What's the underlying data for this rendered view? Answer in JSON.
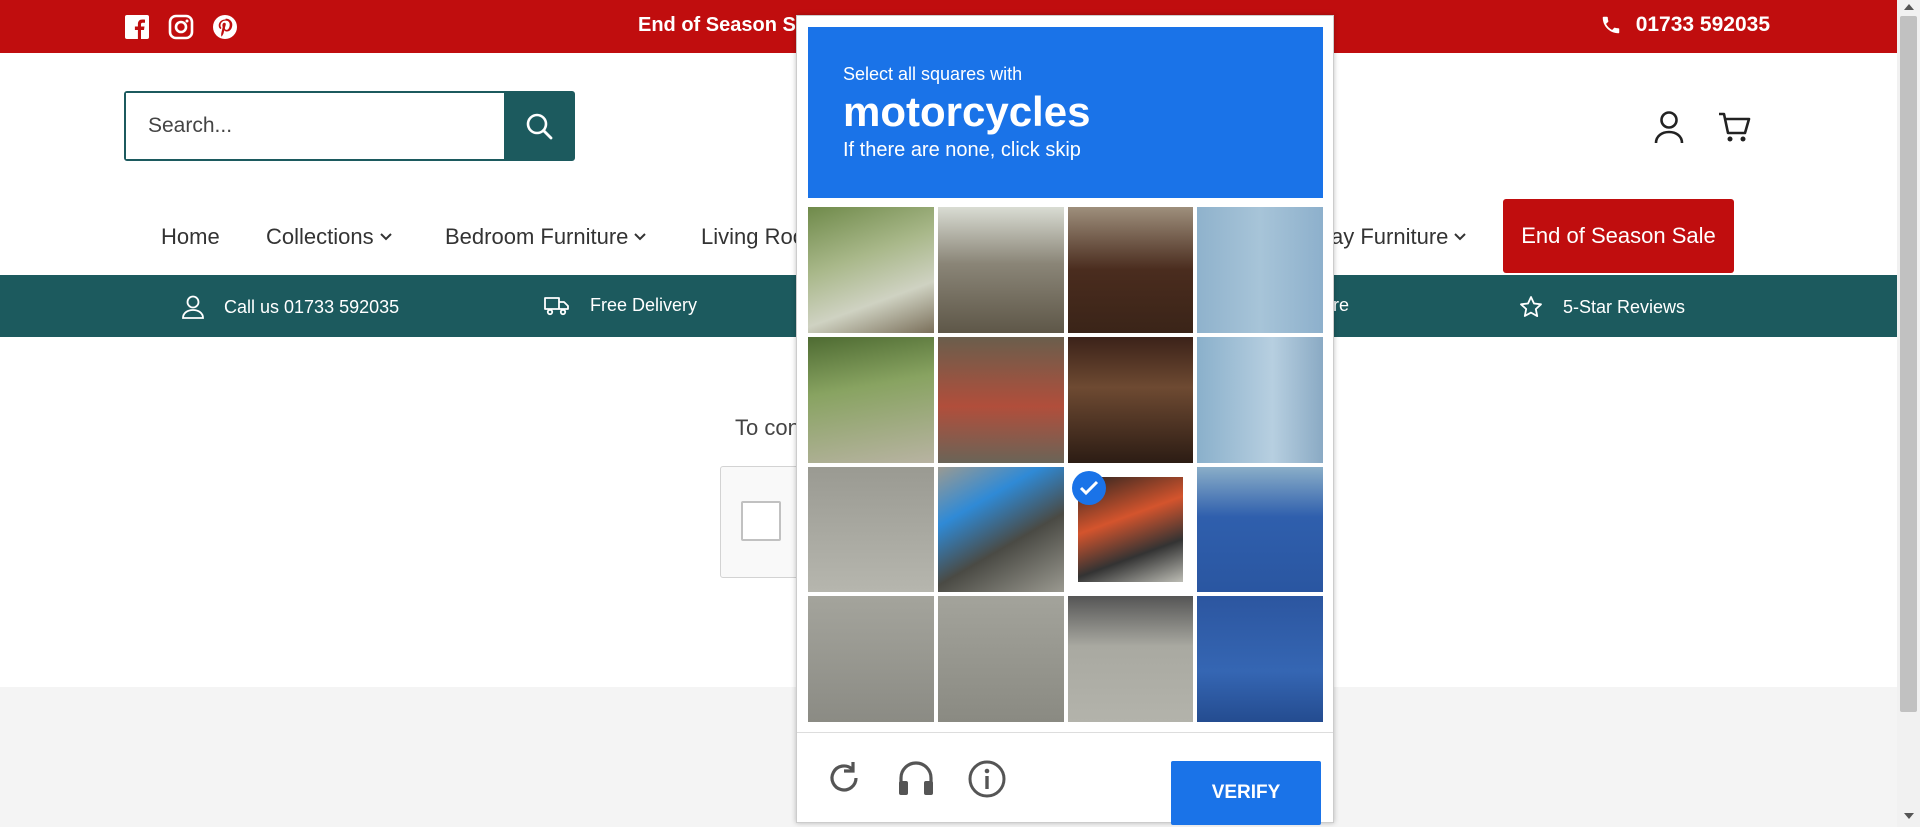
{
  "topbar": {
    "promo": "End of Season Sa",
    "phone": "01733 592035",
    "social": [
      "facebook-icon",
      "instagram-icon",
      "pinterest-icon"
    ]
  },
  "search": {
    "placeholder": "Search..."
  },
  "nav": {
    "items": [
      "Home",
      "Collections",
      "Bedroom Furniture",
      "Living Roo",
      "vay Furniture"
    ],
    "sale": "End of Season Sale"
  },
  "infobar": {
    "call": "Call us 01733 592035",
    "delivery": "Free Delivery",
    "store": "ore",
    "reviews": "5-Star Reviews"
  },
  "main": {
    "text": "To con"
  },
  "captcha": {
    "line1": "Select all squares with",
    "line2": "motorcycles",
    "line3": "If there are none, click skip",
    "verify": "VERIFY",
    "selected_tiles": [
      10
    ]
  },
  "colors": {
    "brand_red": "#c00d0e",
    "teal": "#1c5a5e",
    "captcha_blue": "#1a73e8"
  }
}
